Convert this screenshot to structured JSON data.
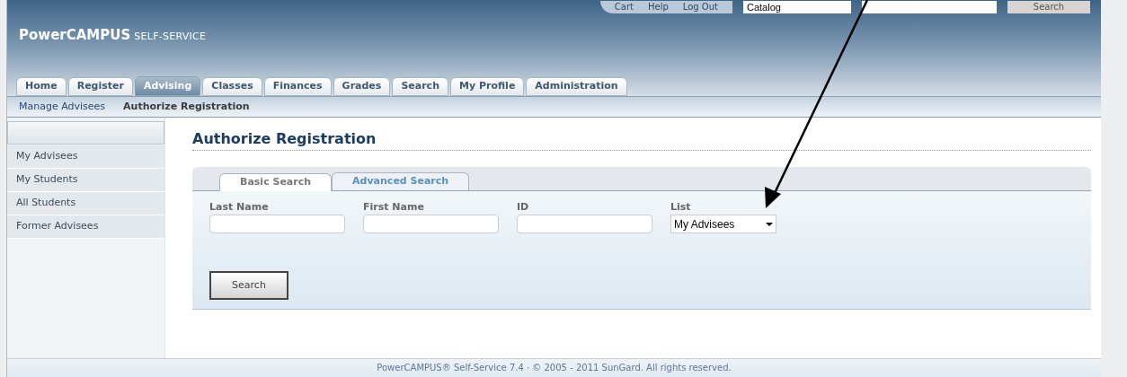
{
  "header": {
    "brand": "PowerCAMPUS",
    "brand_suffix": "SELF-SERVICE",
    "links": [
      "Cart",
      "Help",
      "Log Out"
    ],
    "catalog_select": "Catalog",
    "search_button": "Search"
  },
  "tabs": [
    {
      "label": "Home",
      "selected": false
    },
    {
      "label": "Register",
      "selected": false
    },
    {
      "label": "Advising",
      "selected": true
    },
    {
      "label": "Classes",
      "selected": false
    },
    {
      "label": "Finances",
      "selected": false
    },
    {
      "label": "Grades",
      "selected": false
    },
    {
      "label": "Search",
      "selected": false
    },
    {
      "label": "My Profile",
      "selected": false
    },
    {
      "label": "Administration",
      "selected": false
    }
  ],
  "subnav": [
    {
      "label": "Manage Advisees",
      "selected": false
    },
    {
      "label": "Authorize Registration",
      "selected": true
    }
  ],
  "sidebar": {
    "items": [
      "My Advisees",
      "My Students",
      "All Students",
      "Former Advisees"
    ]
  },
  "page_title": "Authorize Registration",
  "search_tabs": [
    {
      "label": "Basic Search",
      "selected": true
    },
    {
      "label": "Advanced Search",
      "selected": false
    }
  ],
  "fields": [
    {
      "kind": "text",
      "label": "Last Name"
    },
    {
      "kind": "text",
      "label": "First Name"
    },
    {
      "kind": "text",
      "label": "ID"
    },
    {
      "kind": "select",
      "label": "List",
      "value": "My Advisees"
    }
  ],
  "search_button": "Search",
  "footer": "PowerCAMPUS® Self-Service 7.4 · © 2005 - 2011 SunGard. All rights reserved."
}
